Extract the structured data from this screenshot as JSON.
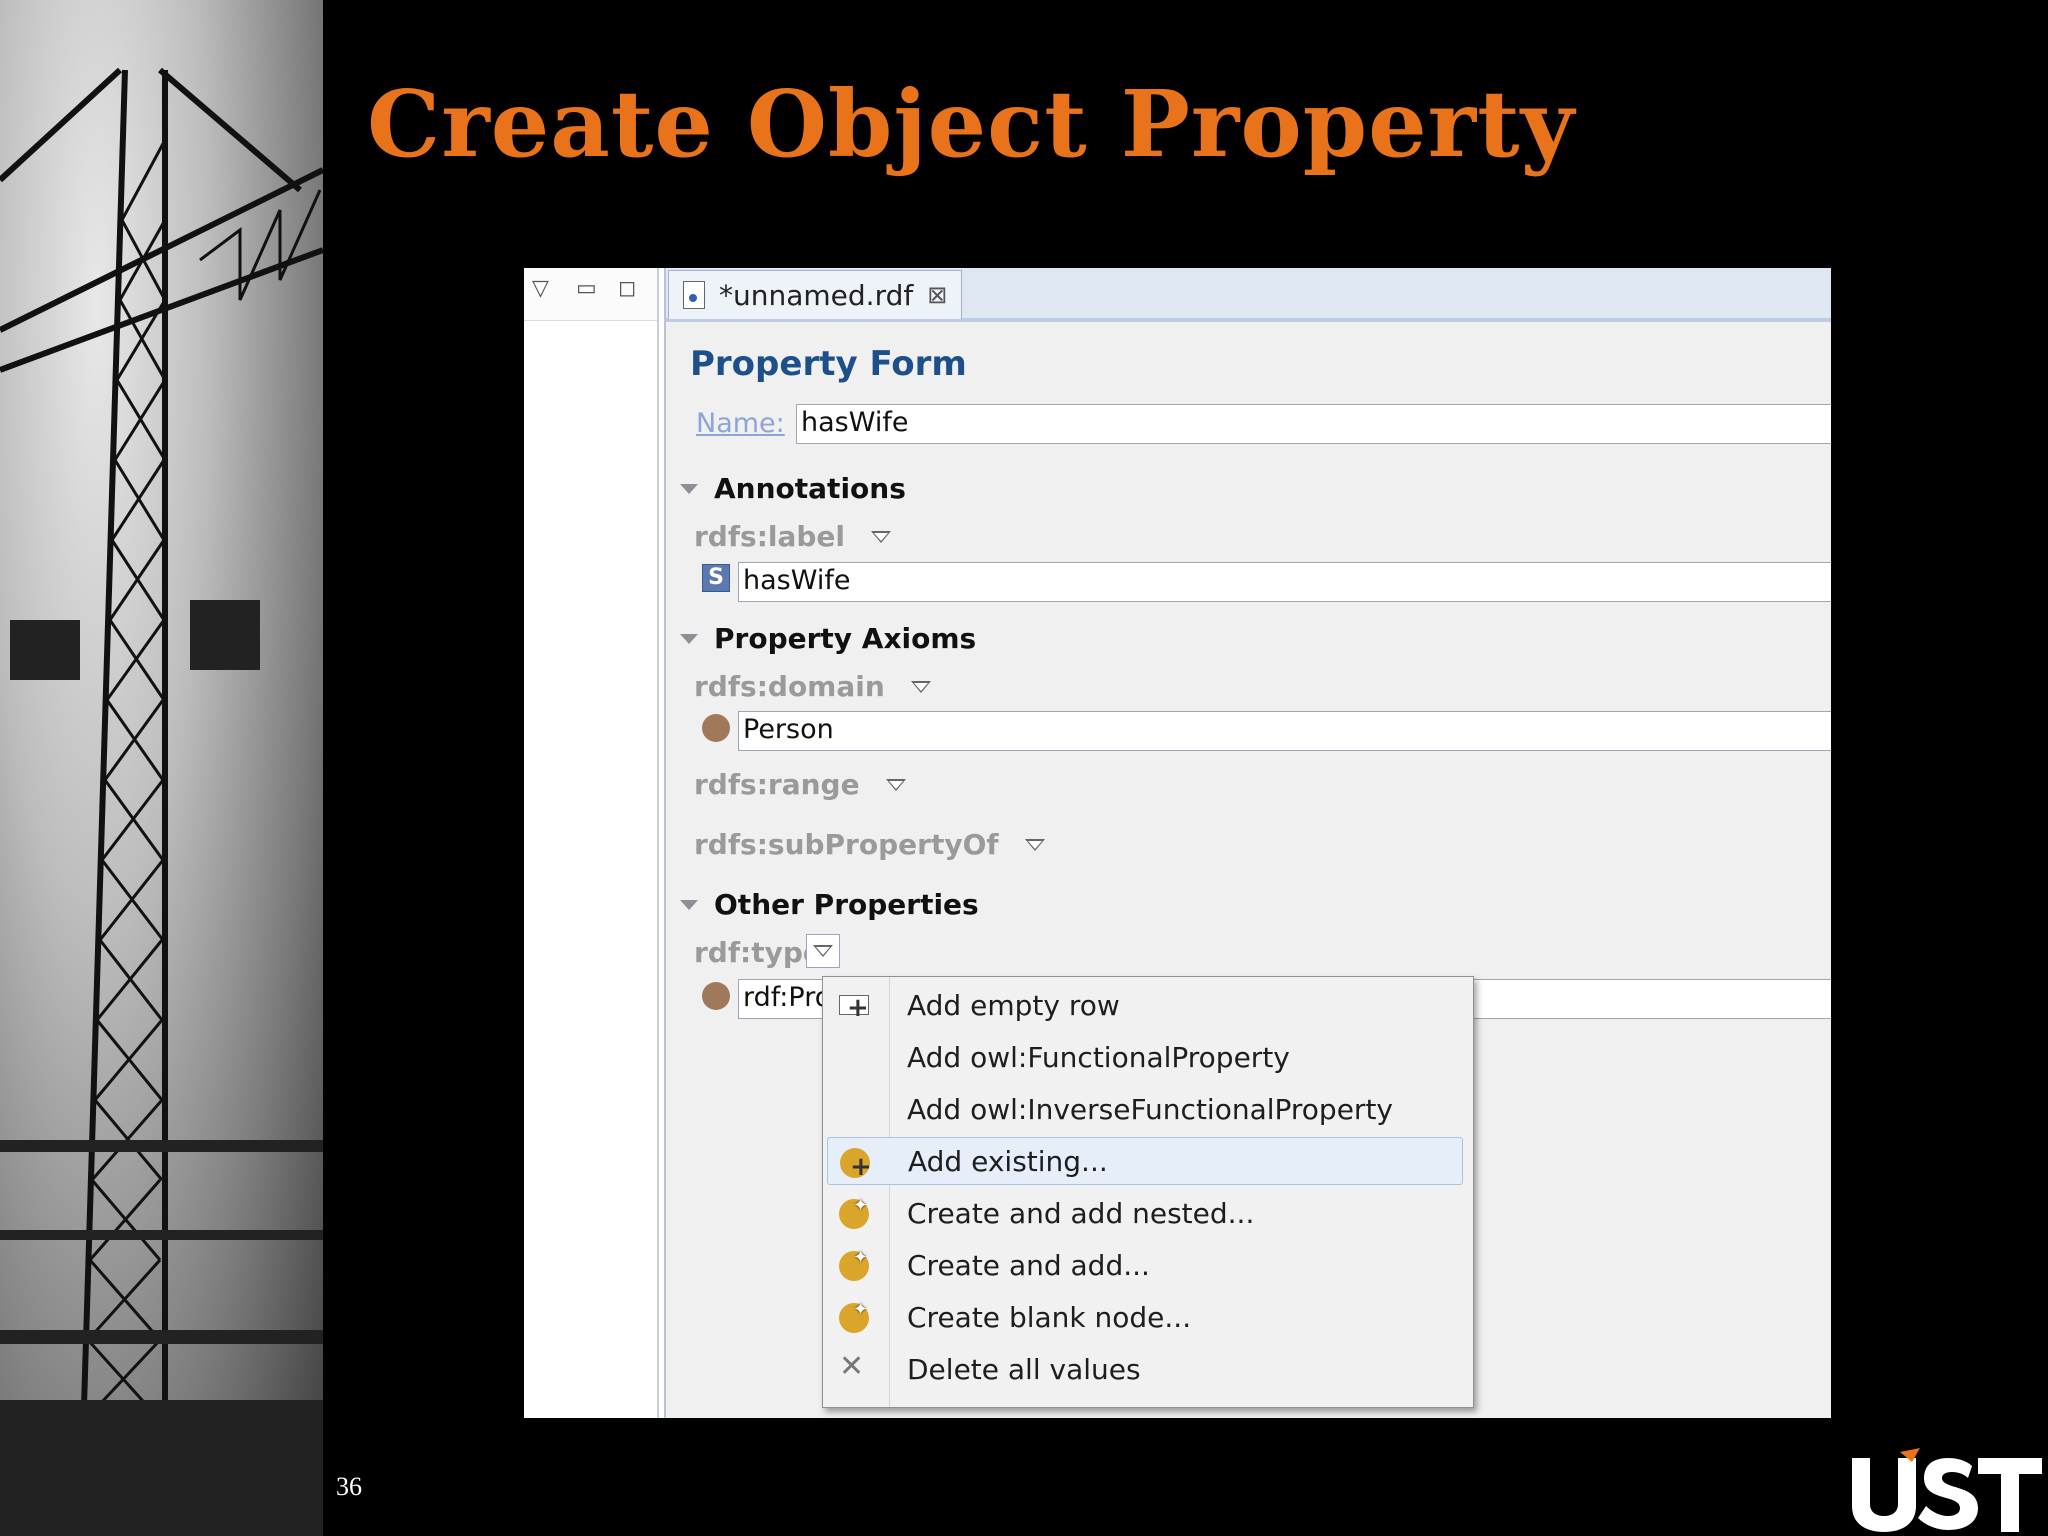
{
  "slide": {
    "title": "Create Object Property",
    "page_number": "36",
    "logo_text": "UST"
  },
  "window": {
    "tab_label": "*unnamed.rdf",
    "tab_close": "⊠",
    "form_title": "Property Form",
    "name_label": "Name:",
    "name_value": "hasWife",
    "sections": {
      "annotations": "Annotations",
      "axioms": "Property Axioms",
      "other": "Other Properties"
    },
    "properties": {
      "label": "rdfs:label",
      "label_value": "hasWife",
      "label_icon": "S",
      "domain": "rdfs:domain",
      "domain_value": "Person",
      "range": "rdfs:range",
      "subproperty": "rdfs:subPropertyOf",
      "type": "rdf:type",
      "type_value": "rdf:Pro"
    }
  },
  "context_menu": {
    "items": [
      {
        "label": "Add empty row",
        "icon": "add-row-icon"
      },
      {
        "label": "Add owl:FunctionalProperty",
        "icon": ""
      },
      {
        "label": "Add owl:InverseFunctionalProperty",
        "icon": ""
      },
      {
        "label": "Add existing...",
        "icon": "add-existing-icon",
        "highlighted": true
      },
      {
        "label": "Create and add nested...",
        "icon": "create-icon"
      },
      {
        "label": "Create and add...",
        "icon": "create-icon"
      },
      {
        "label": "Create blank node...",
        "icon": "create-icon"
      },
      {
        "label": "Delete all values",
        "icon": "delete-icon"
      }
    ]
  },
  "colors": {
    "title": "#e8731a",
    "form_title": "#1d4f8a",
    "highlight": "#e6eef9"
  }
}
